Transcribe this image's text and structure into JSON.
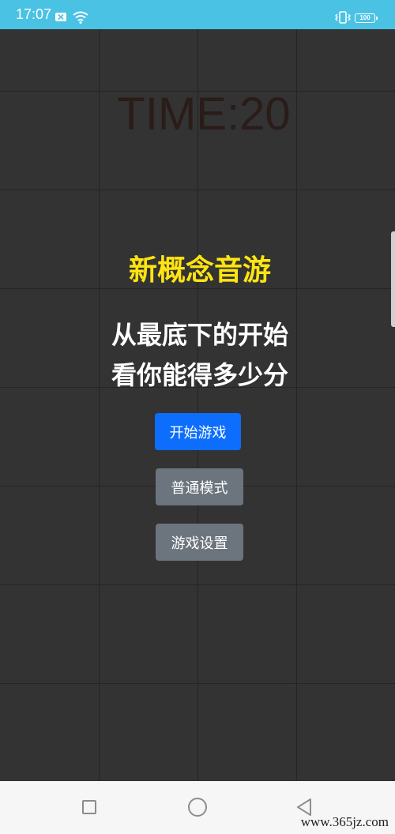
{
  "status_bar": {
    "time": "17:07",
    "battery": "100",
    "icons": [
      "mail-x-icon",
      "wifi-icon",
      "vibrate-icon",
      "battery-icon"
    ],
    "background": "#4ac2e4"
  },
  "game": {
    "timer": "TIME:20",
    "title": "新概念音游",
    "subtitle_line1": "从最底下的开始",
    "subtitle_line2": "看你能得多少分",
    "grid": {
      "columns": 4,
      "rows": 8
    },
    "colors": {
      "background": "#333333",
      "title": "#ffe411",
      "timer": "#2a1c18",
      "grid_line": "#252525"
    }
  },
  "buttons": {
    "start": "开始游戏",
    "mode": "普通模式",
    "settings": "游戏设置",
    "colors": {
      "primary": "#0d6efd",
      "secondary": "#6c757d"
    }
  },
  "nav_bar": {
    "icons": [
      "recent-apps-icon",
      "home-icon",
      "back-icon"
    ]
  },
  "watermark": "www.365jz.com"
}
